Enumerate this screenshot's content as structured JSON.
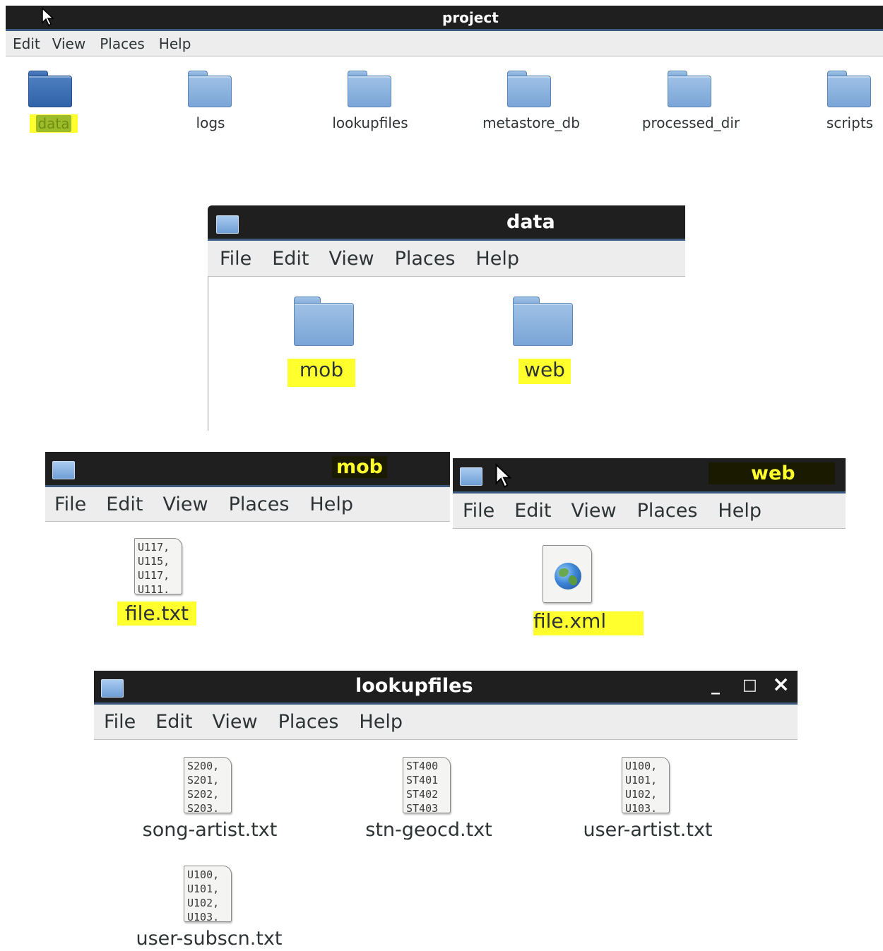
{
  "project_window": {
    "title": "project",
    "menu": [
      "Edit",
      "View",
      "Places",
      "Help"
    ],
    "items": [
      {
        "label": "data",
        "selected": true
      },
      {
        "label": "logs"
      },
      {
        "label": "lookupfiles"
      },
      {
        "label": "metastore_db"
      },
      {
        "label": "processed_dir"
      },
      {
        "label": "scripts"
      }
    ]
  },
  "data_window": {
    "title": "data",
    "menu": [
      "File",
      "Edit",
      "View",
      "Places",
      "Help"
    ],
    "items": [
      {
        "label": "mob"
      },
      {
        "label": "web"
      }
    ]
  },
  "mob_window": {
    "title": "mob",
    "menu": [
      "File",
      "Edit",
      "View",
      "Places",
      "Help"
    ],
    "items": [
      {
        "label": "file.txt",
        "preview": [
          "U117,",
          "U115,",
          "U117,",
          "U111."
        ]
      }
    ]
  },
  "web_window": {
    "title": "web",
    "menu": [
      "File",
      "Edit",
      "View",
      "Places",
      "Help"
    ],
    "items": [
      {
        "label": "file.xml",
        "icon": "globe-icon"
      }
    ]
  },
  "lookupfiles_window": {
    "title": "lookupfiles",
    "menu": [
      "File",
      "Edit",
      "View",
      "Places",
      "Help"
    ],
    "controls": {
      "minimize": "_",
      "maximize": "□",
      "close": "×"
    },
    "items": [
      {
        "label": "song-artist.txt",
        "preview": [
          "S200,",
          "S201,",
          "S202,",
          "S203."
        ]
      },
      {
        "label": "stn-geocd.txt",
        "preview": [
          "ST400",
          "ST401",
          "ST402",
          "ST403"
        ]
      },
      {
        "label": "user-artist.txt",
        "preview": [
          "U100,",
          "U101,",
          "U102,",
          "U103."
        ]
      },
      {
        "label": "user-subscn.txt",
        "preview": [
          "U100,",
          "U101,",
          "U102,",
          "U103."
        ]
      }
    ]
  },
  "colors": {
    "titlebar": "#1f1f1f",
    "highlight": "#ffff2e",
    "folder": "#7aa5d6",
    "menubar": "#ededed"
  }
}
